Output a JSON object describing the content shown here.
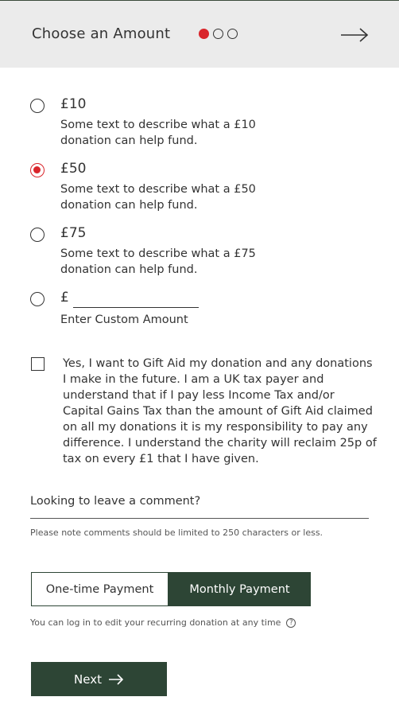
{
  "header": {
    "title": "Choose an Amount",
    "step_current": 1,
    "step_total": 3
  },
  "options": [
    {
      "amount": "£10",
      "description": "Some text to describe what a £10 donation can help fund.",
      "selected": false
    },
    {
      "amount": "£50",
      "description": "Some text to describe what a £50 donation can help fund.",
      "selected": true
    },
    {
      "amount": "£75",
      "description": "Some text to describe what a £75 donation can help fund.",
      "selected": false
    }
  ],
  "custom": {
    "currency": "£",
    "value": "",
    "label": "Enter Custom Amount"
  },
  "gift_aid": {
    "checked": false,
    "text": "Yes, I want to Gift Aid my donation and any donations I make in the future. I am a UK tax payer and understand that if I pay less Income Tax and/or Capital Gains Tax than the amount of Gift Aid claimed on all my donations it is my responsibility to pay any difference. I understand the charity will reclaim 25p of tax on every £1 that I have given."
  },
  "comment": {
    "placeholder": "Looking to leave a comment?",
    "note": "Please note comments should be limited to 250 characters or less."
  },
  "payment": {
    "one_time_label": "One-time Payment",
    "monthly_label": "Monthly Payment",
    "selected": "monthly",
    "note": "You can log in to edit your recurring donation at any time"
  },
  "next_button": {
    "label": "Next"
  },
  "colors": {
    "accent_red": "#d9252b",
    "brand_green": "#2d4535",
    "header_bg": "#ebebeb"
  }
}
